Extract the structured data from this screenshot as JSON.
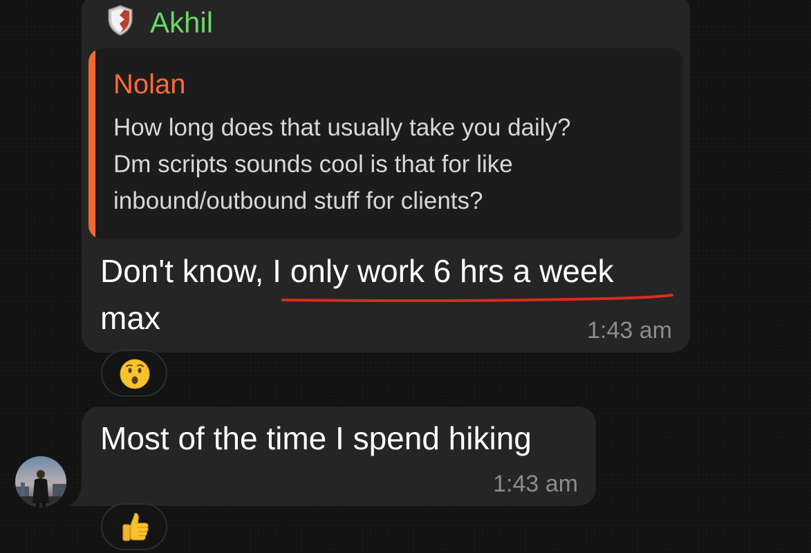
{
  "messages": [
    {
      "sender": "Akhil",
      "reply": {
        "name": "Nolan",
        "lines": [
          "How long does that usually take you daily?",
          "Dm scripts sounds cool is that for like",
          "inbound/outbound stuff for clients?"
        ]
      },
      "lines": [
        "Don't know, I only work 6 hrs a week",
        "max"
      ],
      "time": "1:43 am",
      "reaction": "astonished-face-emoji"
    },
    {
      "lines": [
        "Most of the time I spend hiking"
      ],
      "time": "1:43 am",
      "reaction": "thumbs-up-emoji"
    }
  ],
  "colors": {
    "background": "#131313",
    "bubble": "#252525",
    "sender_name": "#6ad86a",
    "reply_name": "#ff6b35",
    "reply_bar": "#ee6a32",
    "underline": "#e02a1e",
    "timestamp": "#8c8c8c"
  }
}
